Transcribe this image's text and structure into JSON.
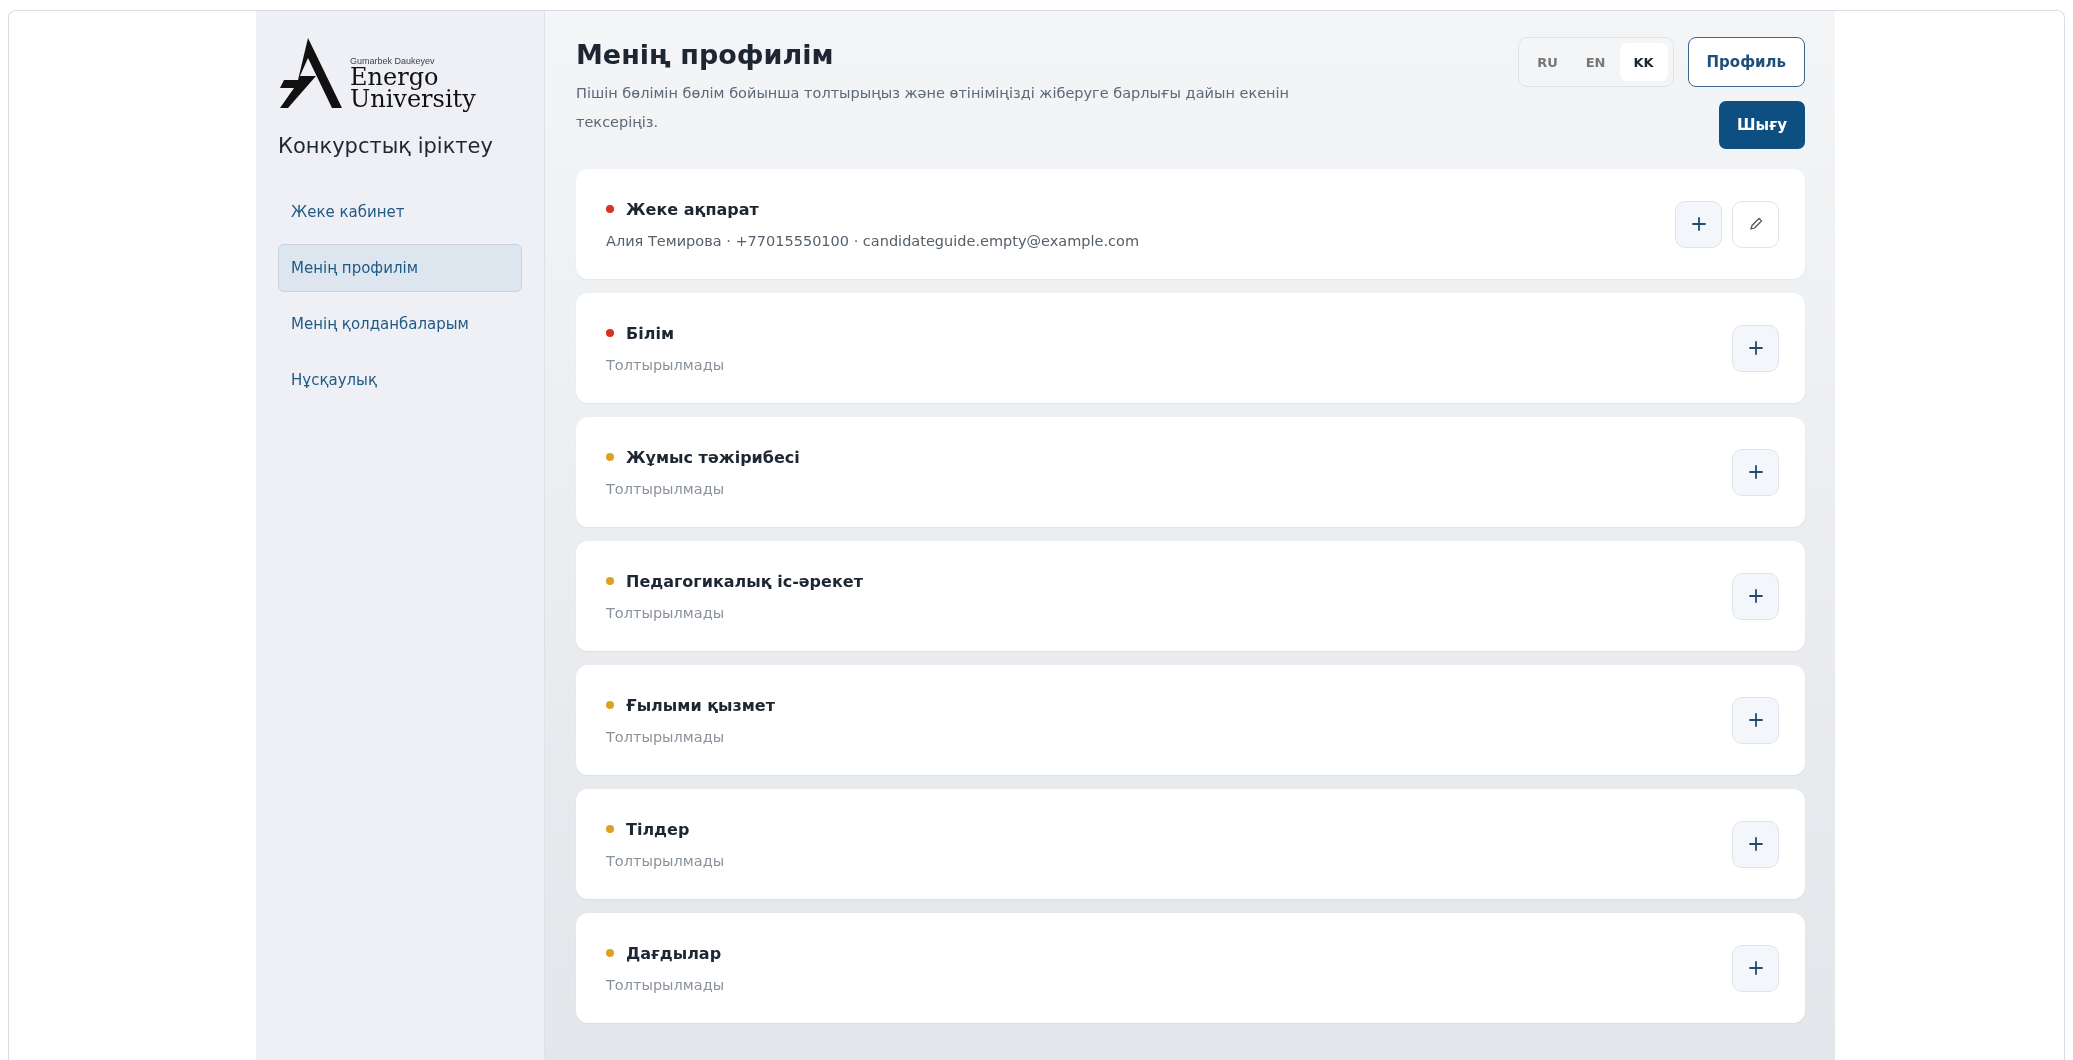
{
  "logo": {
    "tagline": "Gumarbek Daukeyev",
    "line1": "Energo",
    "line2": "University"
  },
  "sidebar": {
    "title": "Конкурстық іріктеу",
    "items": [
      {
        "label": "Жеке кабинет",
        "selected": false
      },
      {
        "label": "Менің профилім",
        "selected": true
      },
      {
        "label": "Менің қолданбаларым",
        "selected": false
      },
      {
        "label": "Нұсқаулық",
        "selected": false
      }
    ]
  },
  "header": {
    "title": "Менің профилім",
    "subtitle": "Пішін бөлімін бөлім бойынша толтырыңыз және өтініміңізді жіберуге барлығы дайын екенін тексеріңіз."
  },
  "languages": [
    {
      "label": "RU",
      "selected": false
    },
    {
      "label": "EN",
      "selected": false
    },
    {
      "label": "KK",
      "selected": true
    }
  ],
  "profile_button": "Профиль",
  "logout_button": "Шығу",
  "sections": [
    {
      "title": "Жеке ақпарат",
      "summary": "Алия Темирова · +77015550100 · candidateguide.empty@example.com",
      "filled": true,
      "color": "#d93025",
      "editable": true
    },
    {
      "title": "Білім",
      "summary": "Толтырылмады",
      "filled": false,
      "color": "#d93025",
      "editable": false
    },
    {
      "title": "Жұмыс тәжірибесі",
      "summary": "Толтырылмады",
      "filled": false,
      "color": "#e0a020",
      "editable": false
    },
    {
      "title": "Педагогикалық іс-әрекет",
      "summary": "Толтырылмады",
      "filled": false,
      "color": "#e0a020",
      "editable": false
    },
    {
      "title": "Ғылыми қызмет",
      "summary": "Толтырылмады",
      "filled": false,
      "color": "#e0a020",
      "editable": false
    },
    {
      "title": "Тілдер",
      "summary": "Толтырылмады",
      "filled": false,
      "color": "#e0a020",
      "editable": false
    },
    {
      "title": "Дағдылар",
      "summary": "Толтырылмады",
      "filled": false,
      "color": "#e0a020",
      "editable": false
    }
  ]
}
